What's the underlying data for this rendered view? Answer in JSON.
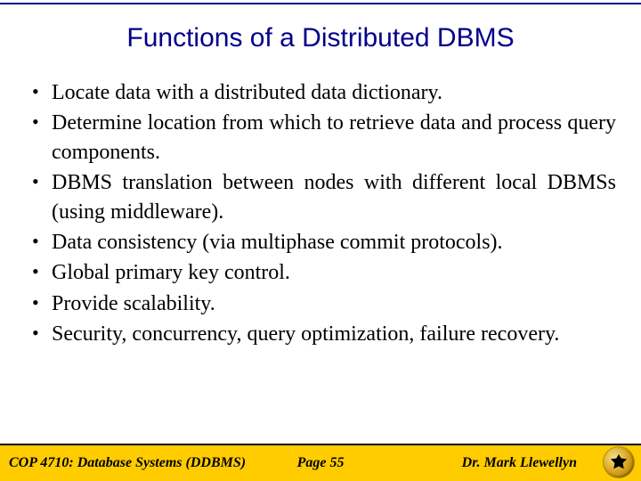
{
  "title": "Functions of a Distributed DBMS",
  "bullets": [
    "Locate data with a distributed data dictionary.",
    "Determine location from which to retrieve data and process query components.",
    "DBMS translation between nodes with different local DBMSs (using middleware).",
    "Data consistency (via multiphase commit protocols).",
    "Global primary key control.",
    "Provide scalability.",
    "Security, concurrency, query optimization, failure recovery."
  ],
  "footer": {
    "course": "COP 4710: Database Systems  (DDBMS)",
    "page": "Page 55",
    "author": "Dr. Mark Llewellyn"
  }
}
